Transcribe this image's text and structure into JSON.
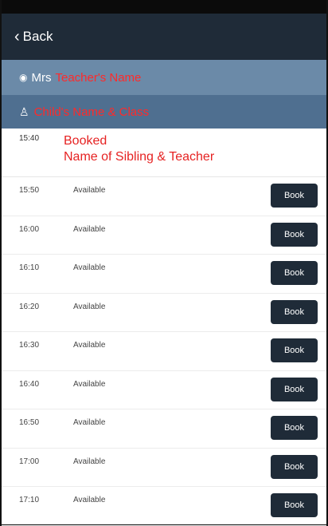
{
  "navbar": {
    "back_label": "Back"
  },
  "teacher": {
    "prefix": "Mrs",
    "name": "Teacher's Name"
  },
  "child": {
    "label": "Child's Name & Class"
  },
  "booked_slot": {
    "time": "15:40",
    "status_line1": "Booked",
    "status_line2": "Name of Sibling & Teacher"
  },
  "slots": [
    {
      "time": "15:50",
      "status": "Available",
      "button": "Book"
    },
    {
      "time": "16:00",
      "status": "Available",
      "button": "Book"
    },
    {
      "time": "16:10",
      "status": "Available",
      "button": "Book"
    },
    {
      "time": "16:20",
      "status": "Available",
      "button": "Book"
    },
    {
      "time": "16:30",
      "status": "Available",
      "button": "Book"
    },
    {
      "time": "16:40",
      "status": "Available",
      "button": "Book"
    },
    {
      "time": "16:50",
      "status": "Available",
      "button": "Book"
    },
    {
      "time": "17:00",
      "status": "Available",
      "button": "Book"
    },
    {
      "time": "17:10",
      "status": "Available",
      "button": "Book"
    }
  ],
  "colors": {
    "navbar": "#1f2b38",
    "teacher_bar": "#6b8aa8",
    "child_bar": "#4f6f90",
    "highlight_text": "#ff2a2a",
    "book_button": "#1f2b38"
  }
}
